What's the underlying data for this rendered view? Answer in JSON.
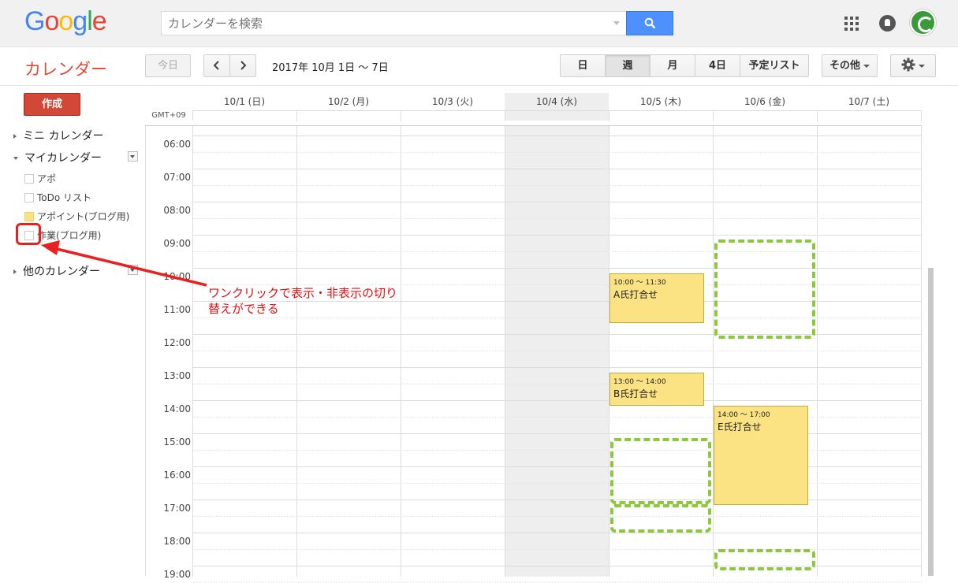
{
  "brand": {
    "logo_letters": [
      "G",
      "o",
      "o",
      "g",
      "l",
      "e"
    ],
    "logo_colors": [
      "#4285f4",
      "#ea4335",
      "#fbbc05",
      "#4285f4",
      "#34a853",
      "#ea4335"
    ],
    "app_title": "カレンダー"
  },
  "search": {
    "placeholder": "カレンダーを検索",
    "value": ""
  },
  "topbar_icons": [
    "apps-grid-icon",
    "notifications-bell-icon",
    "account-avatar"
  ],
  "toolbar": {
    "today": "今日",
    "date_range": "2017年 10月 1日 ～ 7日",
    "views": [
      "日",
      "週",
      "月",
      "4日",
      "予定リスト"
    ],
    "active_view": "週",
    "more": "その他",
    "settings_icon": "gear-icon"
  },
  "sidebar": {
    "create": "作成",
    "mini_calendar": "ミニ カレンダー",
    "my_calendars": "マイカレンダー",
    "calendars": [
      {
        "label": "アポ",
        "checked": false,
        "color": "#ffffff"
      },
      {
        "label": "ToDo リスト",
        "checked": false,
        "color": "#ffffff"
      },
      {
        "label": "アポイント(ブログ用)",
        "checked": true,
        "color": "#fbe283"
      },
      {
        "label": "作業(ブログ用)",
        "checked": false,
        "color": "#ffffff"
      }
    ],
    "other_calendars": "他のカレンダー"
  },
  "calendar": {
    "timezone": "GMT+09",
    "days": [
      "10/1 (日)",
      "10/2 (月)",
      "10/3 (火)",
      "10/4 (水)",
      "10/5 (木)",
      "10/6 (金)",
      "10/7 (土)"
    ],
    "today_index": 3,
    "hours": [
      "06:00",
      "07:00",
      "08:00",
      "09:00",
      "10:00",
      "11:00",
      "12:00",
      "13:00",
      "14:00",
      "15:00",
      "16:00",
      "17:00",
      "18:00",
      "19:00"
    ],
    "events": [
      {
        "day": 4,
        "start": 10.0,
        "end": 11.5,
        "time": "10:00 ～ 11:30",
        "title": "A氏打合せ",
        "color": "#fbe283"
      },
      {
        "day": 4,
        "start": 13.0,
        "end": 14.0,
        "time": "13:00 ～ 14:00",
        "title": "B氏打合せ",
        "color": "#fbe283"
      },
      {
        "day": 5,
        "start": 14.0,
        "end": 17.0,
        "time": "14:00 ～ 17:00",
        "title": "E氏打合せ",
        "color": "#fbe283"
      }
    ],
    "hidden_slots": [
      {
        "day": 5,
        "start": 9.0,
        "end": 12.0
      },
      {
        "day": 4,
        "start": 15.0,
        "end": 17.0
      },
      {
        "day": 4,
        "start": 17.0,
        "end": 17.85
      },
      {
        "day": 5,
        "start": 18.35,
        "end": 19.0
      }
    ]
  },
  "annotation": {
    "line1": "ワンクリックで表示・非表示の切り",
    "line2": "替えができる",
    "color": "#e01010"
  }
}
